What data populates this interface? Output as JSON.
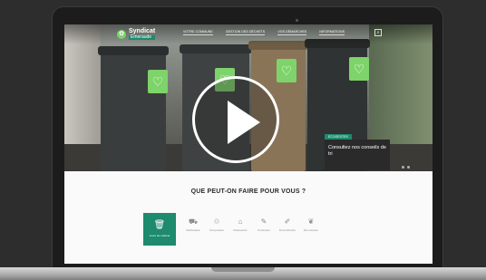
{
  "header": {
    "logo_line1": "Syndicat",
    "logo_line2": "Emeraude",
    "nav": [
      "VOTRE COMMUNE",
      "GESTION DES DÉCHETS",
      "VOS DÉMARCHES",
      "INFORMATIONS"
    ],
    "search_icon": "search-icon"
  },
  "hero": {
    "caption_tag": "ÉCOGESTES",
    "caption_text": "Consultez nos conseils de tri"
  },
  "video": {
    "play_icon": "play-icon"
  },
  "services": {
    "title": "QUE PEUT-ON FAIRE POUR VOUS ?",
    "active": {
      "label": "Jours de collecte",
      "icon": "bin-icon"
    },
    "items": [
      {
        "label": "Déchetterie",
        "icon": "truck-icon"
      },
      {
        "label": "Composteur",
        "icon": "compost-icon"
      },
      {
        "label": "Redevance",
        "icon": "home-icon"
      },
      {
        "label": "Conteneur",
        "icon": "container-icon"
      },
      {
        "label": "Encombrants",
        "icon": "wrench-icon"
      },
      {
        "label": "Éco-Gestes",
        "icon": "leaf-icon"
      }
    ]
  },
  "colors": {
    "accent": "#1e8a6e",
    "tag_green": "#7ed36a",
    "frame": "#1c1c1c"
  }
}
